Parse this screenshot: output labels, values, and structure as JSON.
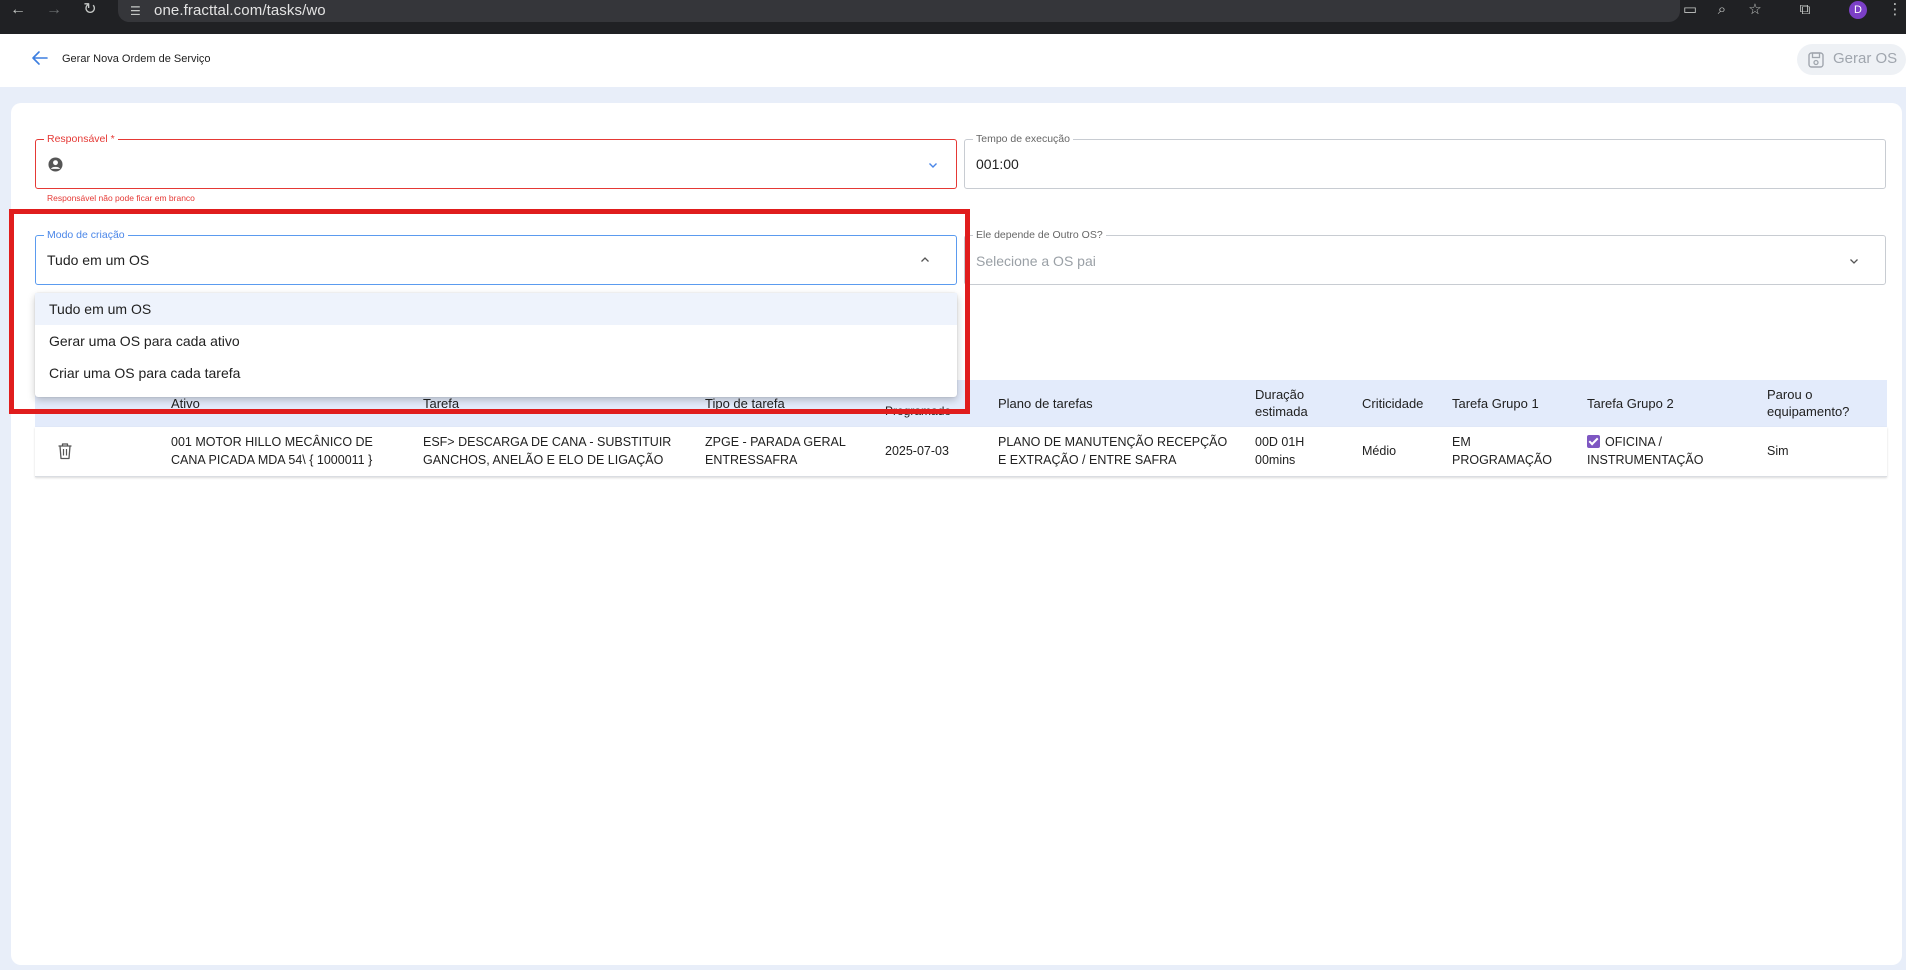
{
  "browser": {
    "url": "one.fracttal.com/tasks/wo",
    "profile_initial": "D"
  },
  "header": {
    "title": "Gerar Nova Ordem de Serviço",
    "gerar_os_label": "Gerar OS"
  },
  "form": {
    "responsavel": {
      "label": "Responsável *",
      "value": "",
      "error": "Responsável não pode ficar em branco"
    },
    "tempo_execucao": {
      "label": "Tempo de execução",
      "value": "001:00"
    },
    "modo_criacao": {
      "label": "Modo de criação",
      "value": "Tudo em um OS",
      "options": [
        "Tudo em um OS",
        "Gerar uma OS para cada ativo",
        "Criar uma OS para cada tarefa"
      ]
    },
    "depende_os": {
      "label": "Ele depende de Outro OS?",
      "placeholder": "Selecione a OS pai"
    }
  },
  "table": {
    "headers": {
      "ativo": "Ativo",
      "tarefa": "Tarefa",
      "tipo": "Tipo de tarefa",
      "programado": "Programado",
      "plano": "Plano de tarefas",
      "duracao": [
        "Duração",
        "estimada"
      ],
      "criticidade": "Criticidade",
      "grupo1": "Tarefa Grupo 1",
      "grupo2": "Tarefa Grupo 2",
      "parou": [
        "Parou o",
        "equipamento?"
      ]
    },
    "row": {
      "ativo": [
        "001 MOTOR HILLO MECÂNICO DE",
        "CANA PICADA MDA 54\\ { 1000011 }"
      ],
      "tarefa": [
        "ESF> DESCARGA DE CANA - SUBSTITUIR",
        "GANCHOS, ANELÃO E ELO DE LIGAÇÃO"
      ],
      "tipo": [
        "ZPGE - PARADA GERAL",
        "ENTRESSAFRA"
      ],
      "programado": "2025-07-03",
      "plano": [
        "PLANO DE MANUTENÇÃO RECEPÇÃO",
        "E EXTRAÇÃO / ENTRE SAFRA"
      ],
      "duracao": [
        "00D 01H",
        "00mins"
      ],
      "criticidade": "Médio",
      "grupo1": [
        "EM",
        "PROGRAMAÇÃO"
      ],
      "grupo2": [
        "OFICINA /",
        "INSTRUMENTAÇÃO"
      ],
      "parou": "Sim"
    }
  },
  "colors": {
    "error": "#e53935",
    "focus": "#4a86e8",
    "highlight": "#e01d1d",
    "table_header_bg": "#e3ebfb",
    "checkbox": "#7e57c2"
  }
}
